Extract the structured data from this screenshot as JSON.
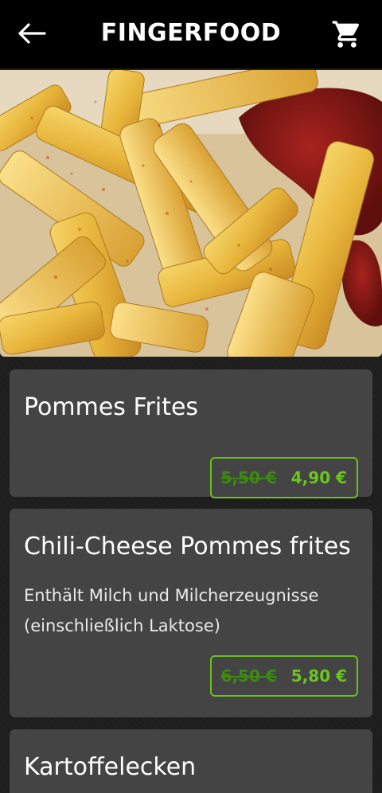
{
  "header": {
    "title": "FINGERFOOD",
    "back_icon": "arrow-left-icon",
    "cart_icon": "cart-icon"
  },
  "hero": {
    "image": "french-fries-with-ketchup"
  },
  "products": [
    {
      "name": "Pommes Frites",
      "description": "",
      "old_price": "5,50 €",
      "new_price": "4,90 €"
    },
    {
      "name": "Chili-Cheese Pommes frites",
      "description_line1": "Enthält Milch und Milcherzeugnisse",
      "description_line2": "(einschließlich Laktose)",
      "old_price": "6,50 €",
      "new_price": "5,80 €"
    },
    {
      "name": "Kartoffelecken"
    }
  ],
  "colors": {
    "header_bg": "#000000",
    "card_bg": "#444444",
    "accent_green": "#6ac61f",
    "old_price_green": "#3d8a12"
  }
}
